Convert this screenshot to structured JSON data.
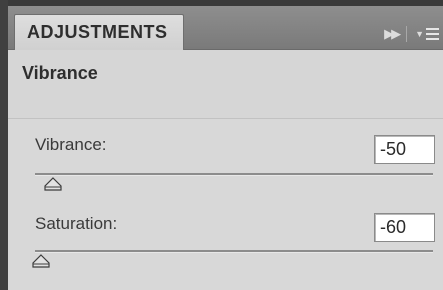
{
  "panel": {
    "tab_label": "ADJUSTMENTS",
    "title": "Vibrance"
  },
  "sliders": [
    {
      "label": "Vibrance:",
      "value": "-50",
      "range": [
        -100,
        100
      ]
    },
    {
      "label": "Saturation:",
      "value": "-60",
      "range": [
        -100,
        100
      ]
    }
  ],
  "icons": {
    "expand": "double-chevron-right-icon",
    "menu": "panel-menu-icon",
    "thumb": "slider-thumb-icon"
  },
  "colors": {
    "panel_bg": "#d6d6d6",
    "tabbar_bg": "#828282"
  }
}
